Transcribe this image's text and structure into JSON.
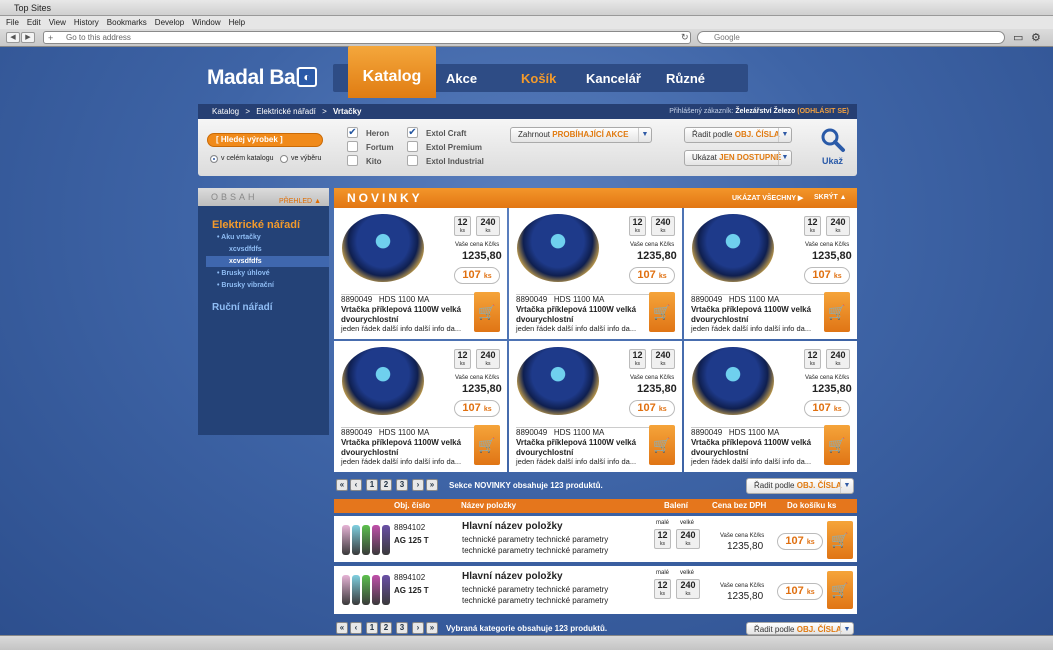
{
  "window": {
    "title": "Top Sites"
  },
  "menu": [
    "File",
    "Edit",
    "View",
    "History",
    "Bookmarks",
    "Develop",
    "Window",
    "Help"
  ],
  "toolbar": {
    "address_placeholder": "Go to this address",
    "search_placeholder": "Google"
  },
  "brand": {
    "name": "Madal Bal"
  },
  "nav": {
    "katalog": "Katalog",
    "akce": "Akce",
    "kosik": "Košík",
    "kancelar": "Kancelář",
    "ruzne": "Různé"
  },
  "breadcrumb": {
    "c1": "Katalog",
    "c2": "Elektrické nářadí",
    "c3": "Vrtačky",
    "sep": ">",
    "customer_label": "Přihlášený zákazník:",
    "customer": "Železářství Železo",
    "logout": "(ODHLÁSIT SE)"
  },
  "filter": {
    "search_btn": "[ Hledej výrobek ]",
    "scope_all": "v celém katalogu",
    "scope_sel": "ve výběru",
    "brands": [
      "Heron",
      "Fortum",
      "Kito",
      "Extol Craft",
      "Extol Premium",
      "Extol Industrial"
    ],
    "include_prefix": "Zahrnout",
    "include_value": "PROBÍHAJÍCÍ AKCE",
    "sort_prefix": "Řadit podle",
    "sort_value": "OBJ. ČÍSLA",
    "show_prefix": "Ukázat",
    "show_value": "JEN DOSTUPNÉ",
    "search_label": "Ukaž"
  },
  "sidebar": {
    "title": "OBSAH",
    "overview": "PŘEHLED",
    "cat1": "Elektrické nářadí",
    "sub1": "• Aku vrtačky",
    "sub1a": "xcvsdfdfs",
    "sub1b": "xcvsdfdfs",
    "sub2": "• Brusky úhlové",
    "sub3": "• Brusky vibrační",
    "cat2": "Ruční nářadí"
  },
  "novinky": {
    "title": "NOVINKY",
    "show_all": "UKÁZAT VŠECHNY",
    "hide": "SKRÝT"
  },
  "product": {
    "qty_small": "12",
    "qty_large": "240",
    "unit": "ks",
    "price_label": "Vaše cena Kč/ks",
    "price": "1235,80",
    "pack_price": "107",
    "pack_unit": "ks",
    "code": "8890049",
    "model": "HDS 1100 MA",
    "name": "Vrtačka příklepová 1100W velká dvourychlostní",
    "info": "jeden řádek další info další info da..."
  },
  "pager": {
    "pages": [
      "«",
      "‹",
      "1",
      "2",
      "3",
      "›",
      "»"
    ],
    "novinky_info": "Sekce NOVINKY obsahuje 123 produktů.",
    "category_info": "Vybraná kategorie obsahuje 123 produktů."
  },
  "table": {
    "headers": [
      "Obj. číslo",
      "Název položky",
      "Balení",
      "Cena bez DPH",
      "Do košíku ks"
    ],
    "pack_small_label": "malé",
    "pack_large_label": "velké",
    "rows": [
      {
        "code": "8894102",
        "model": "AG 125 T",
        "title": "Hlavní název položky",
        "params1": "technické parametry technické parametry",
        "params2": "technické parametry technické parametry"
      },
      {
        "code": "8894102",
        "model": "AG 125 T",
        "title": "Hlavní název položky",
        "params1": "technické parametry technické parametry",
        "params2": "technické parametry technické parametry"
      }
    ]
  },
  "colors": {
    "accent": "#e8841a",
    "nav_bg": "#2e4c85",
    "page_bg": "#3e64a6"
  }
}
